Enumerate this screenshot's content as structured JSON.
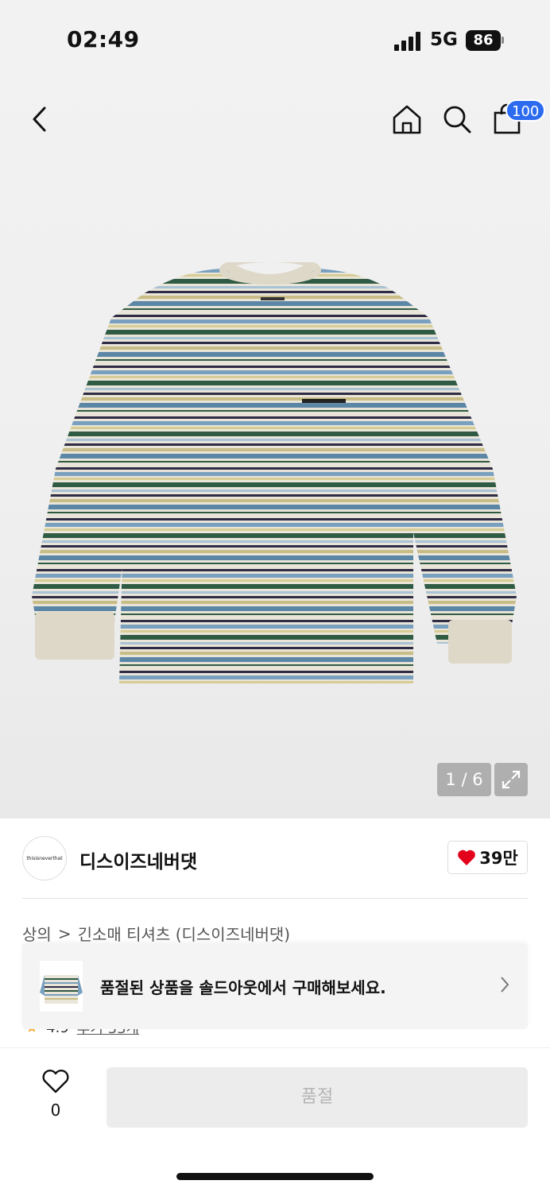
{
  "status_bar": {
    "time": "02:49",
    "network": "5G",
    "battery": "86"
  },
  "nav": {
    "back_icon": "chevron-left-icon",
    "home_icon": "home-icon",
    "search_icon": "search-icon",
    "cart_icon": "shopping-bag-icon",
    "cart_badge": "100"
  },
  "gallery": {
    "pager": "1 / 6",
    "expand_icon": "expand-icon",
    "product_image": "striped long-sleeve t-shirt"
  },
  "brand": {
    "logo_text": "thisisneverthat",
    "name": "디스이즈네버댓",
    "like_count": "39만",
    "like_icon": "heart-icon"
  },
  "breadcrumb": {
    "category": "상의",
    "separator": ">",
    "subcategory": "긴소매 티셔츠 (디스이즈네버댓)"
  },
  "soldout_banner": {
    "text": "품절된 상품을 솔드아웃에서 구매해보세요.",
    "arrow_icon": "chevron-right-icon"
  },
  "rating": {
    "score": "4.9",
    "review_count": "후기 33개"
  },
  "bottom": {
    "wish_icon": "heart-outline-icon",
    "wish_count": "0",
    "buy_label": "품절"
  },
  "colors": {
    "accent_blue": "#2c6bf0",
    "heart_red": "#e3001b",
    "button_gray": "#ececec"
  }
}
